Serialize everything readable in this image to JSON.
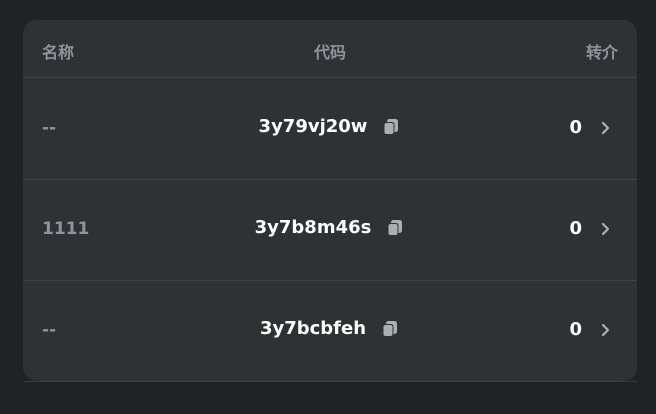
{
  "table": {
    "headers": {
      "name": "名称",
      "code": "代码",
      "referrals": "转介"
    },
    "rows": [
      {
        "name": "--",
        "code": "3y79vj20w",
        "referrals": "0"
      },
      {
        "name": "1111",
        "code": "3y7b8m46s",
        "referrals": "0"
      },
      {
        "name": "--",
        "code": "3y7bcbfeh",
        "referrals": "0"
      }
    ]
  },
  "icons": {
    "copy": "copy-icon",
    "chevron": "chevron-right-icon"
  },
  "colors": {
    "background": "#202325",
    "card": "#2e3235",
    "divider": "#3f4447",
    "muted_text": "#8e9599",
    "primary_text": "#ffffff",
    "icon": "#a9b0b4"
  }
}
